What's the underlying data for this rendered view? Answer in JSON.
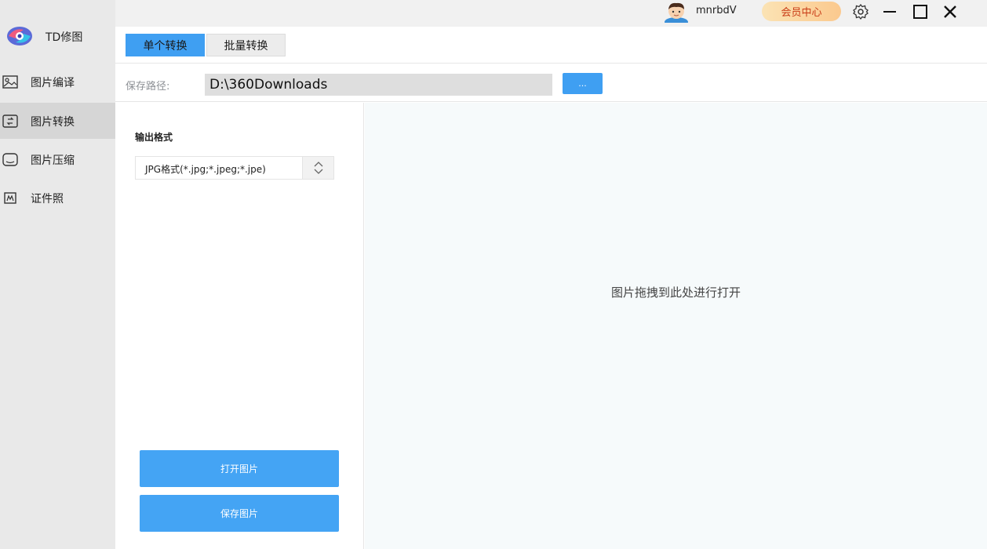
{
  "app": {
    "name": "TD修图"
  },
  "sidebar": {
    "items": [
      {
        "label": "图片编译",
        "icon": "image-edit-icon",
        "active": false
      },
      {
        "label": "图片转换",
        "icon": "image-convert-icon",
        "active": true
      },
      {
        "label": "图片压缩",
        "icon": "image-compress-icon",
        "active": false
      },
      {
        "label": "证件照",
        "icon": "id-photo-icon",
        "active": false
      }
    ]
  },
  "titlebar": {
    "username": "mnrbdV",
    "vip_label": "会员中心",
    "icons": [
      "settings-icon",
      "minimize-icon",
      "maximize-icon",
      "close-icon"
    ]
  },
  "tabs": [
    {
      "label": "单个转换",
      "active": true
    },
    {
      "label": "批量转换",
      "active": false
    }
  ],
  "save_path": {
    "label": "保存路径:",
    "value": "D:\\360Downloads",
    "browse_label": "..."
  },
  "output": {
    "format_label": "输出格式",
    "format_value": "JPG格式(*.jpg;*.jpeg;*.jpe)"
  },
  "actions": {
    "open_label": "打开图片",
    "save_label": "保存图片"
  },
  "dropzone": {
    "hint": "图片拖拽到此处进行打开"
  },
  "colors": {
    "accent": "#3f9ff2",
    "sidebar_bg": "#e9e9e9",
    "vip_text": "#c83a15",
    "dropzone_bg": "#f6fafb"
  }
}
